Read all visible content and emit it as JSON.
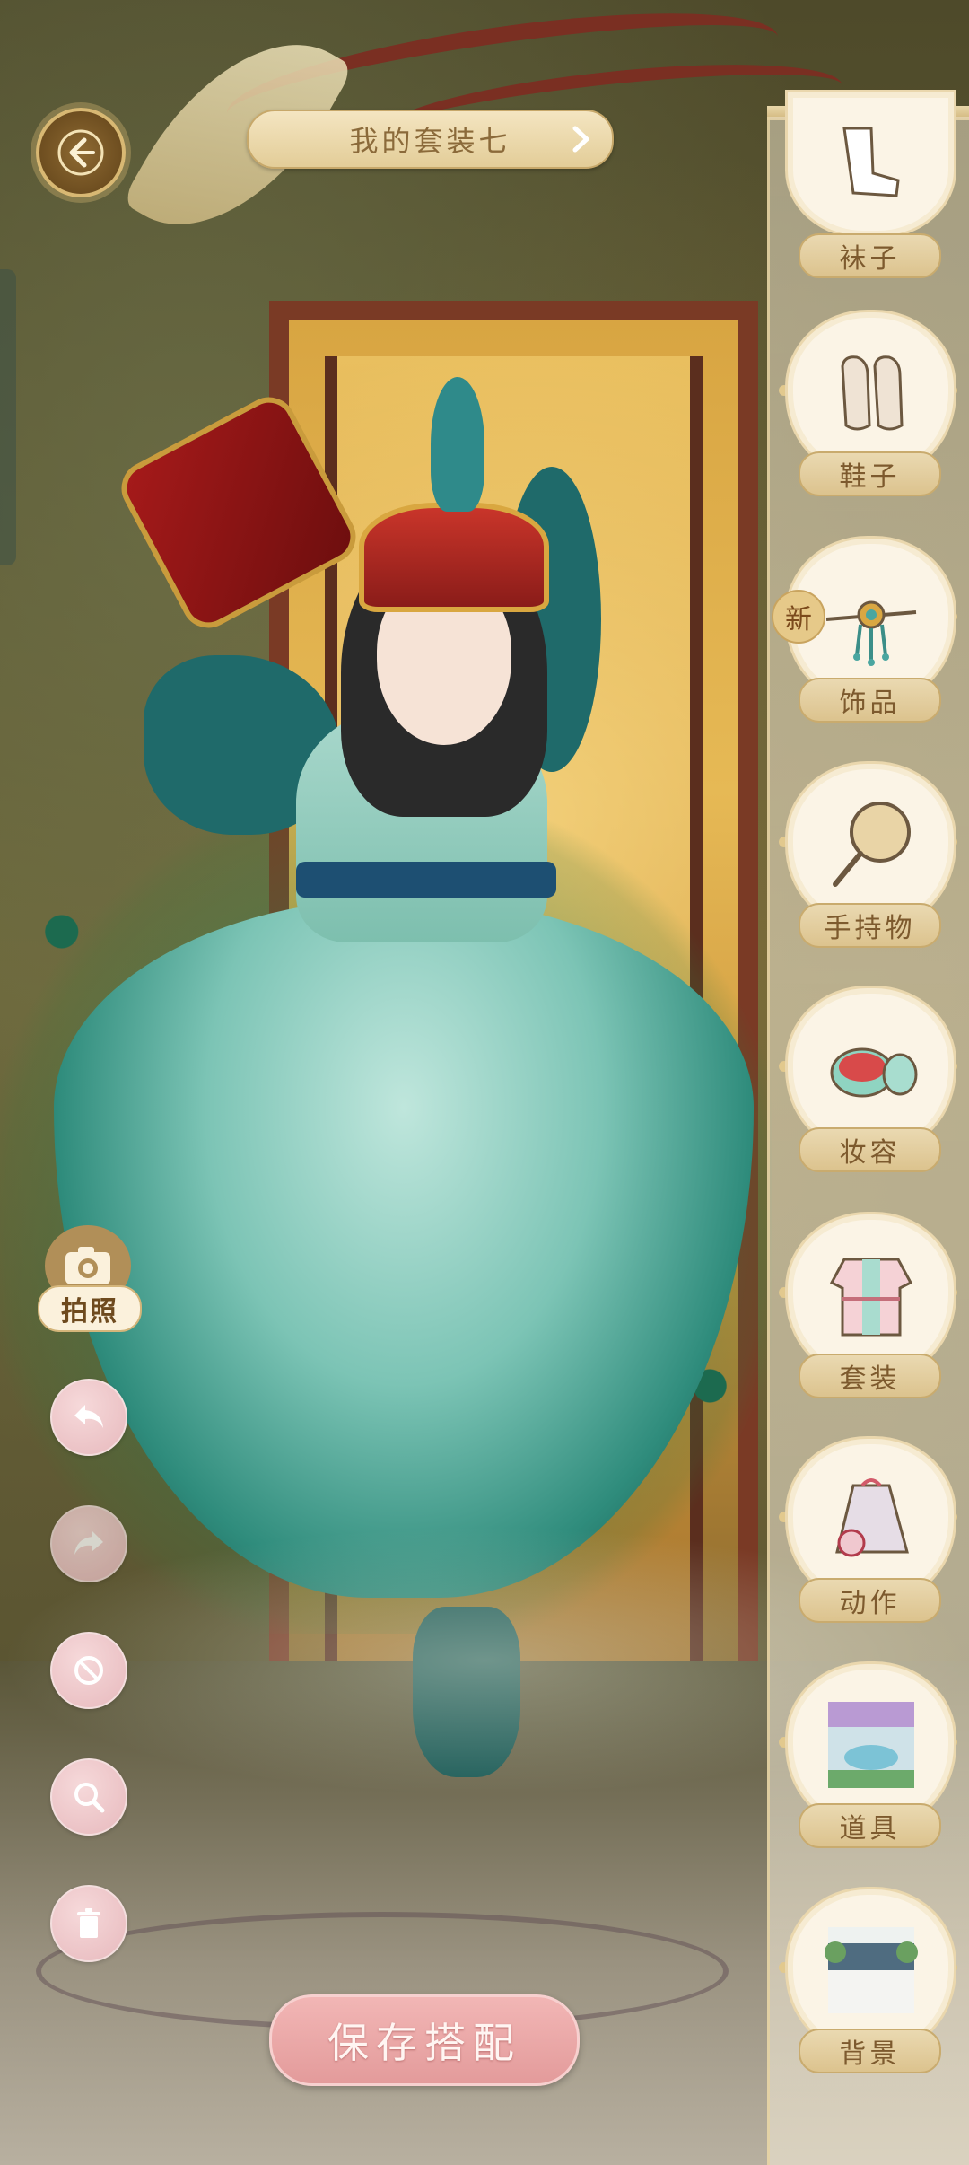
{
  "header": {
    "outfit_title": "我的套装七"
  },
  "sidebar": {
    "categories": [
      {
        "label": "袜子",
        "icon": "socks-icon",
        "new": false
      },
      {
        "label": "鞋子",
        "icon": "shoes-icon",
        "new": false
      },
      {
        "label": "饰品",
        "icon": "hairpin-icon",
        "new": true,
        "badge": "新"
      },
      {
        "label": "手持物",
        "icon": "fan-icon",
        "new": false
      },
      {
        "label": "妆容",
        "icon": "makeup-compact-icon",
        "new": false
      },
      {
        "label": "套装",
        "icon": "outfit-icon",
        "new": false
      },
      {
        "label": "动作",
        "icon": "pose-icon",
        "new": false
      },
      {
        "label": "道具",
        "icon": "scene-prop-icon",
        "new": false
      },
      {
        "label": "背景",
        "icon": "background-icon",
        "new": false
      }
    ]
  },
  "tools": {
    "camera_label": "拍照",
    "undo": "undo-icon",
    "redo": "redo-icon",
    "clear": "prohibit-icon",
    "zoom": "magnifier-icon",
    "delete": "trash-icon"
  },
  "footer": {
    "save_label": "保存搭配"
  },
  "colors": {
    "accent_gold": "#d8b873",
    "label_brown": "#7d5a2e",
    "save_pink": "#e9a6a6",
    "tool_pink": "#eccbcd"
  }
}
